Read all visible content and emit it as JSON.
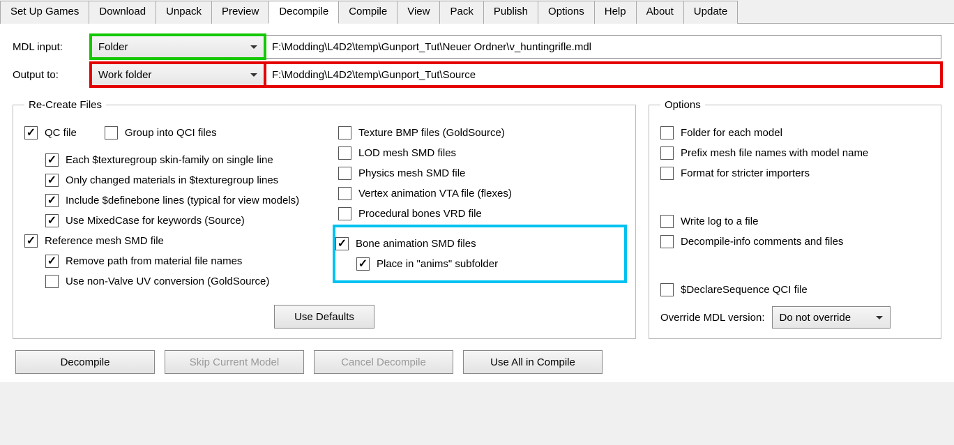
{
  "tabs": [
    "Set Up Games",
    "Download",
    "Unpack",
    "Preview",
    "Decompile",
    "Compile",
    "View",
    "Pack",
    "Publish",
    "Options",
    "Help",
    "About",
    "Update"
  ],
  "active_tab": 4,
  "paths": {
    "mdl_label": "MDL input:",
    "mdl_type": "Folder",
    "mdl_value": "F:\\Modding\\L4D2\\temp\\Gunport_Tut\\Neuer Ordner\\v_huntingrifle.mdl",
    "out_label": "Output to:",
    "out_type": "Work folder",
    "out_value": "F:\\Modding\\L4D2\\temp\\Gunport_Tut\\Source"
  },
  "recreate": {
    "legend": "Re-Create Files",
    "col1": [
      {
        "label": "QC file",
        "checked": true,
        "indent": 0
      },
      {
        "label": "Group into QCI files",
        "checked": false,
        "indent": 0,
        "inline": true
      },
      {
        "label": "Each $texturegroup skin-family on single line",
        "checked": true,
        "indent": 1
      },
      {
        "label": "Only changed materials in $texturegroup lines",
        "checked": true,
        "indent": 1
      },
      {
        "label": "Include $definebone lines (typical for view models)",
        "checked": true,
        "indent": 1
      },
      {
        "label": "Use MixedCase for keywords (Source)",
        "checked": true,
        "indent": 1
      },
      {
        "label": "Reference mesh SMD file",
        "checked": true,
        "indent": 0
      },
      {
        "label": "Remove path from material file names",
        "checked": true,
        "indent": 1
      },
      {
        "label": "Use non-Valve UV conversion (GoldSource)",
        "checked": false,
        "indent": 1
      }
    ],
    "col2": [
      {
        "label": "Texture BMP files (GoldSource)",
        "checked": false
      },
      {
        "label": "LOD mesh SMD files",
        "checked": false
      },
      {
        "label": "Physics mesh SMD file",
        "checked": false
      },
      {
        "label": "Vertex animation VTA file (flexes)",
        "checked": false
      },
      {
        "label": "Procedural bones VRD file",
        "checked": false
      },
      {
        "label": "Bone animation SMD files",
        "checked": true
      },
      {
        "label": "Place in \"anims\" subfolder",
        "checked": true,
        "indent": 1
      }
    ],
    "use_defaults": "Use Defaults"
  },
  "options": {
    "legend": "Options",
    "items": [
      {
        "label": "Folder for each model",
        "checked": false
      },
      {
        "label": "Prefix mesh file names with model name",
        "checked": false
      },
      {
        "label": "Format for stricter importers",
        "checked": false
      },
      {
        "label": "",
        "spacer": true
      },
      {
        "label": "Write log to a file",
        "checked": false
      },
      {
        "label": "Decompile-info comments and files",
        "checked": false
      },
      {
        "label": "",
        "spacer": true
      },
      {
        "label": "$DeclareSequence QCI file",
        "checked": false
      }
    ],
    "override_label": "Override MDL version:",
    "override_value": "Do not override"
  },
  "footer": {
    "decompile": "Decompile",
    "skip": "Skip Current Model",
    "cancel": "Cancel Decompile",
    "useall": "Use All in Compile"
  }
}
